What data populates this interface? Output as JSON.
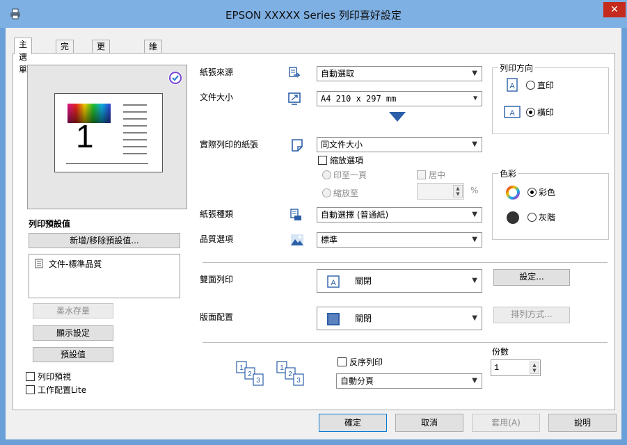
{
  "window": {
    "title": "EPSON XXXXX Series 列印喜好設定",
    "close": "✕"
  },
  "tabs": [
    "主選單",
    "完稿",
    "更多選項",
    "維護"
  ],
  "preview": {
    "page_number": "1"
  },
  "presets": {
    "heading": "列印預設值",
    "add_remove_button": "新增/移除預設值...",
    "items": [
      "文件-標準品質"
    ]
  },
  "left_buttons": {
    "ink_levels": "墨水存量",
    "display_settings": "顯示設定",
    "defaults": "預設值"
  },
  "left_checks": {
    "print_preview": "列印預視",
    "job_arranger": "工作配置Lite"
  },
  "paper_source": {
    "label": "紙張來源",
    "value": "自動選取"
  },
  "document_size": {
    "label": "文件大小",
    "value": "A4 210 x 297 mm"
  },
  "output_paper": {
    "label": "實際列印的紙張",
    "value": "同文件大小"
  },
  "reduce_enlarge": {
    "label": "縮放選項",
    "fit_to_page": "印至一頁",
    "center": "居中",
    "zoom_to": "縮放至",
    "percent": "%"
  },
  "paper_type": {
    "label": "紙張種類",
    "value": "自動選擇 (普通紙)"
  },
  "quality": {
    "label": "品質選項",
    "value": "標準"
  },
  "orientation": {
    "title": "列印方向",
    "portrait": "直印",
    "landscape": "橫印",
    "selected": "landscape"
  },
  "color": {
    "title": "色彩",
    "color": "彩色",
    "grayscale": "灰階",
    "selected": "color"
  },
  "duplex": {
    "label": "雙面列印",
    "value": "關閉",
    "settings_button": "設定..."
  },
  "multipage": {
    "label": "版面配置",
    "value": "關閉",
    "order_button": "排列方式..."
  },
  "copies": {
    "label": "份數",
    "value": "1",
    "reverse_order": "反序列印",
    "collate": "自動分頁"
  },
  "footer": {
    "ok": "確定",
    "cancel": "取消",
    "apply": "套用(A)",
    "help": "說明"
  },
  "colors": {
    "accent_blue": "#2b5fa8",
    "title_bar": "#7fb0e4",
    "close_red": "#c42b1c"
  }
}
